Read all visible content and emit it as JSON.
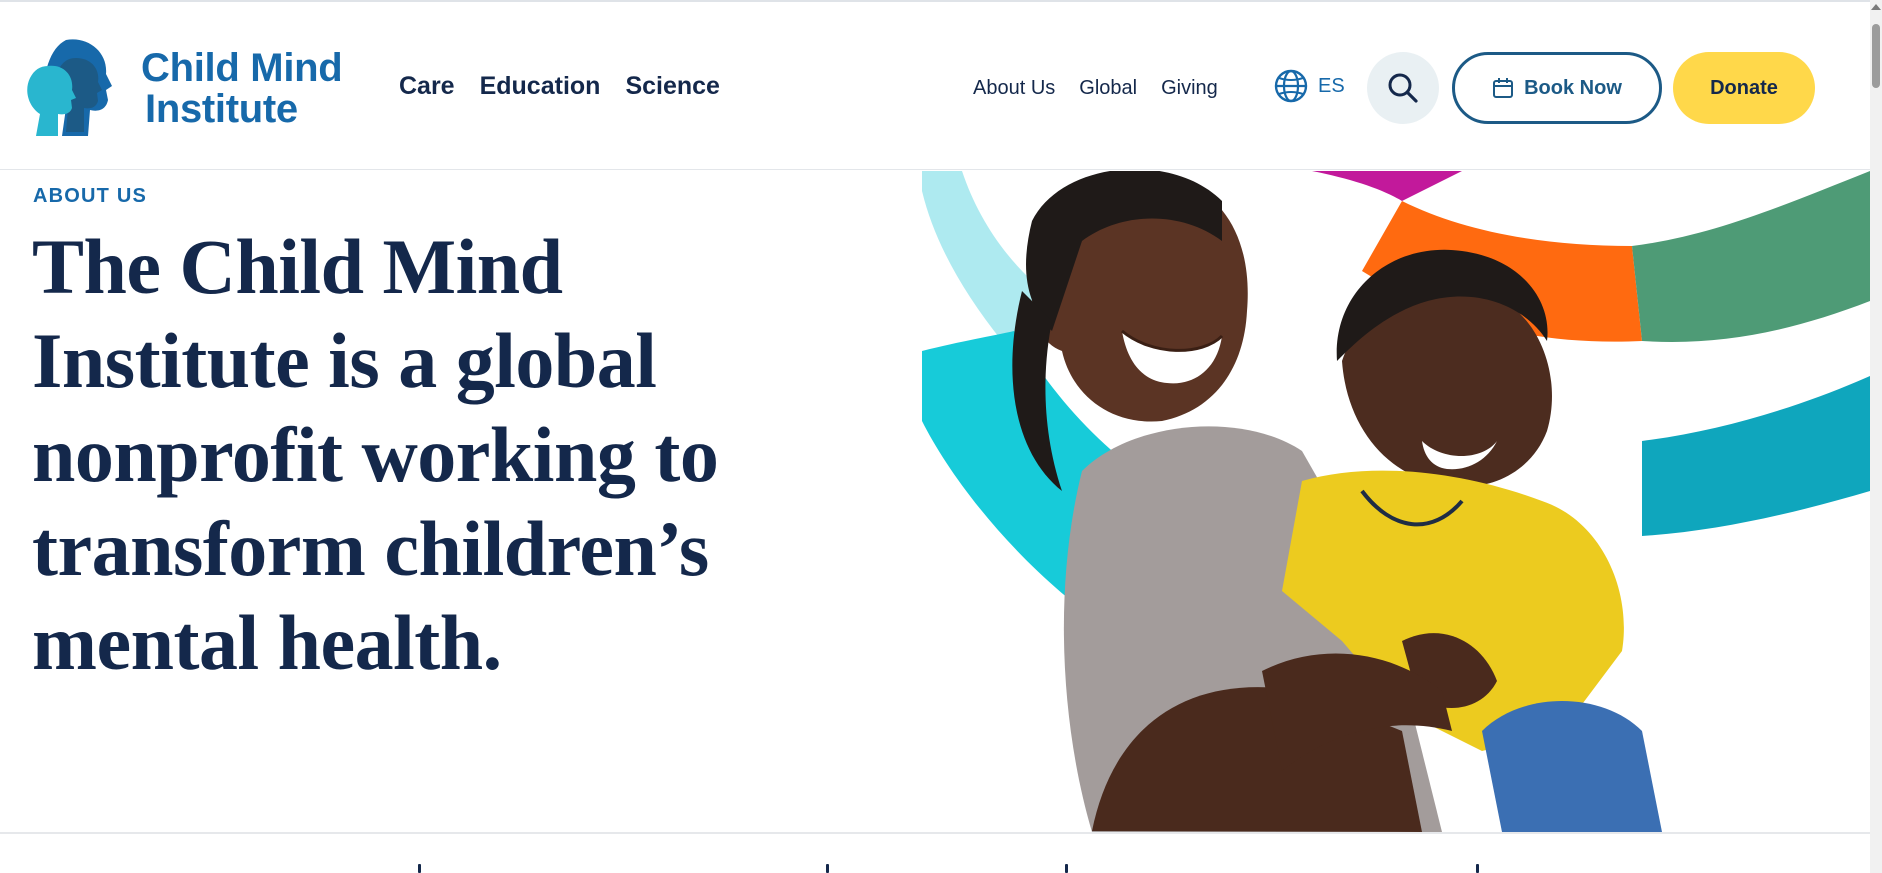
{
  "brand": {
    "name_line1": "Child Mind",
    "name_line2": "Institute",
    "primary_color": "#1769aa",
    "navy_color": "#14284b",
    "accent_yellow": "#ffd84a"
  },
  "main_nav": [
    {
      "label": "Care"
    },
    {
      "label": "Education"
    },
    {
      "label": "Science"
    }
  ],
  "utility_nav": [
    {
      "label": "About Us"
    },
    {
      "label": "Global"
    },
    {
      "label": "Giving"
    }
  ],
  "language": {
    "label": "ES",
    "icon": "globe-icon"
  },
  "search": {
    "icon": "search-icon"
  },
  "book_button": {
    "label": "Book Now",
    "icon": "calendar-icon"
  },
  "donate_button": {
    "label": "Donate"
  },
  "hero": {
    "eyebrow": "ABOUT US",
    "headline_lines": [
      "The Child Mind",
      "Institute is a global",
      "nonprofit working to",
      "transform children’s",
      "mental health."
    ],
    "image": "father-and-son-laughing-photo"
  }
}
